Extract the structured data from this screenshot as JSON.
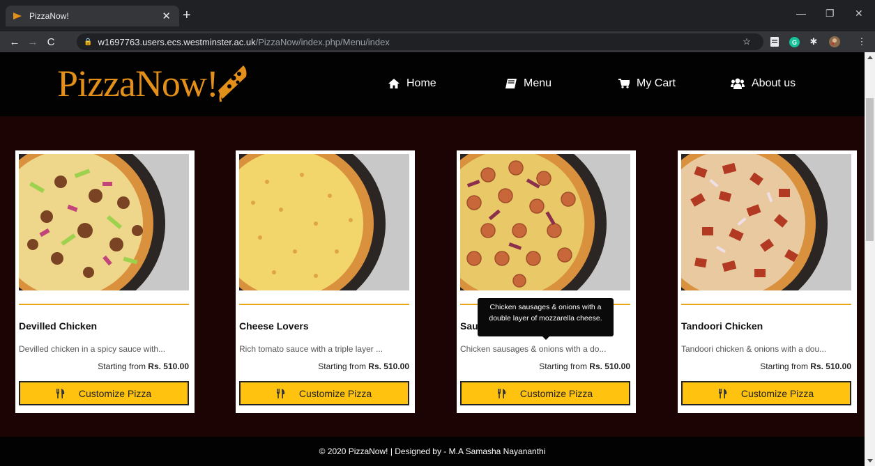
{
  "browser": {
    "tab_title": "PizzaNow!",
    "url_host": "w1697763.users.ecs.westminster.ac.uk",
    "url_path": "/PizzaNow/index.php/Menu/index"
  },
  "site": {
    "logo_text": "PizzaNow!",
    "accent_color": "#e3901a",
    "button_color": "#ffc20e"
  },
  "nav": {
    "home": "Home",
    "menu": "Menu",
    "cart": "My Cart",
    "about": "About us"
  },
  "cards": [
    {
      "name": "Devilled Chicken",
      "desc": "Devilled chicken in a spicy sauce with...",
      "price_prefix": "Starting from ",
      "price": "Rs. 510.00",
      "button": "Customize Pizza"
    },
    {
      "name": "Cheese Lovers",
      "desc": "Rich tomato sauce with a triple layer ...",
      "price_prefix": "Starting from ",
      "price": "Rs. 510.00",
      "button": "Customize Pizza"
    },
    {
      "name": "Sausage Delight",
      "desc": "Chicken sausages & onions with a do...",
      "price_prefix": "Starting from ",
      "price": "Rs. 510.00",
      "button": "Customize Pizza"
    },
    {
      "name": "Tandoori Chicken",
      "desc": "Tandoori chicken & onions with a dou...",
      "price_prefix": "Starting from ",
      "price": "Rs. 510.00",
      "button": "Customize Pizza"
    }
  ],
  "tooltip": {
    "text": "Chicken sausages & onions with a double layer of mozzarella cheese."
  },
  "footer": {
    "text": "© 2020 PizzaNow! | Designed by - M.A Samasha Nayananthi"
  }
}
